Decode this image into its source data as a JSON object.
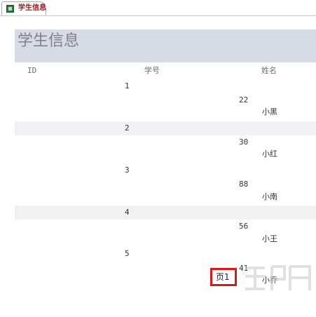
{
  "tab": {
    "label": "学生信息",
    "icon": "report-icon"
  },
  "report": {
    "title": "学生信息",
    "columns": {
      "id": "ID",
      "student_no": "学号",
      "name": "姓名"
    },
    "records": [
      {
        "id": "1",
        "student_no": "22",
        "name": "小黑"
      },
      {
        "id": "2",
        "student_no": "30",
        "name": "小红"
      },
      {
        "id": "3",
        "student_no": "88",
        "name": "小南"
      },
      {
        "id": "4",
        "student_no": "56",
        "name": "小王"
      },
      {
        "id": "5",
        "student_no": "41",
        "name": "小乔"
      }
    ],
    "page_label": "页1"
  },
  "colors": {
    "header_band": "#d7dbe6",
    "alt_band": "#f1f0f3",
    "highlight": "#d41a1a",
    "tab_text": "#8b1a1a"
  }
}
